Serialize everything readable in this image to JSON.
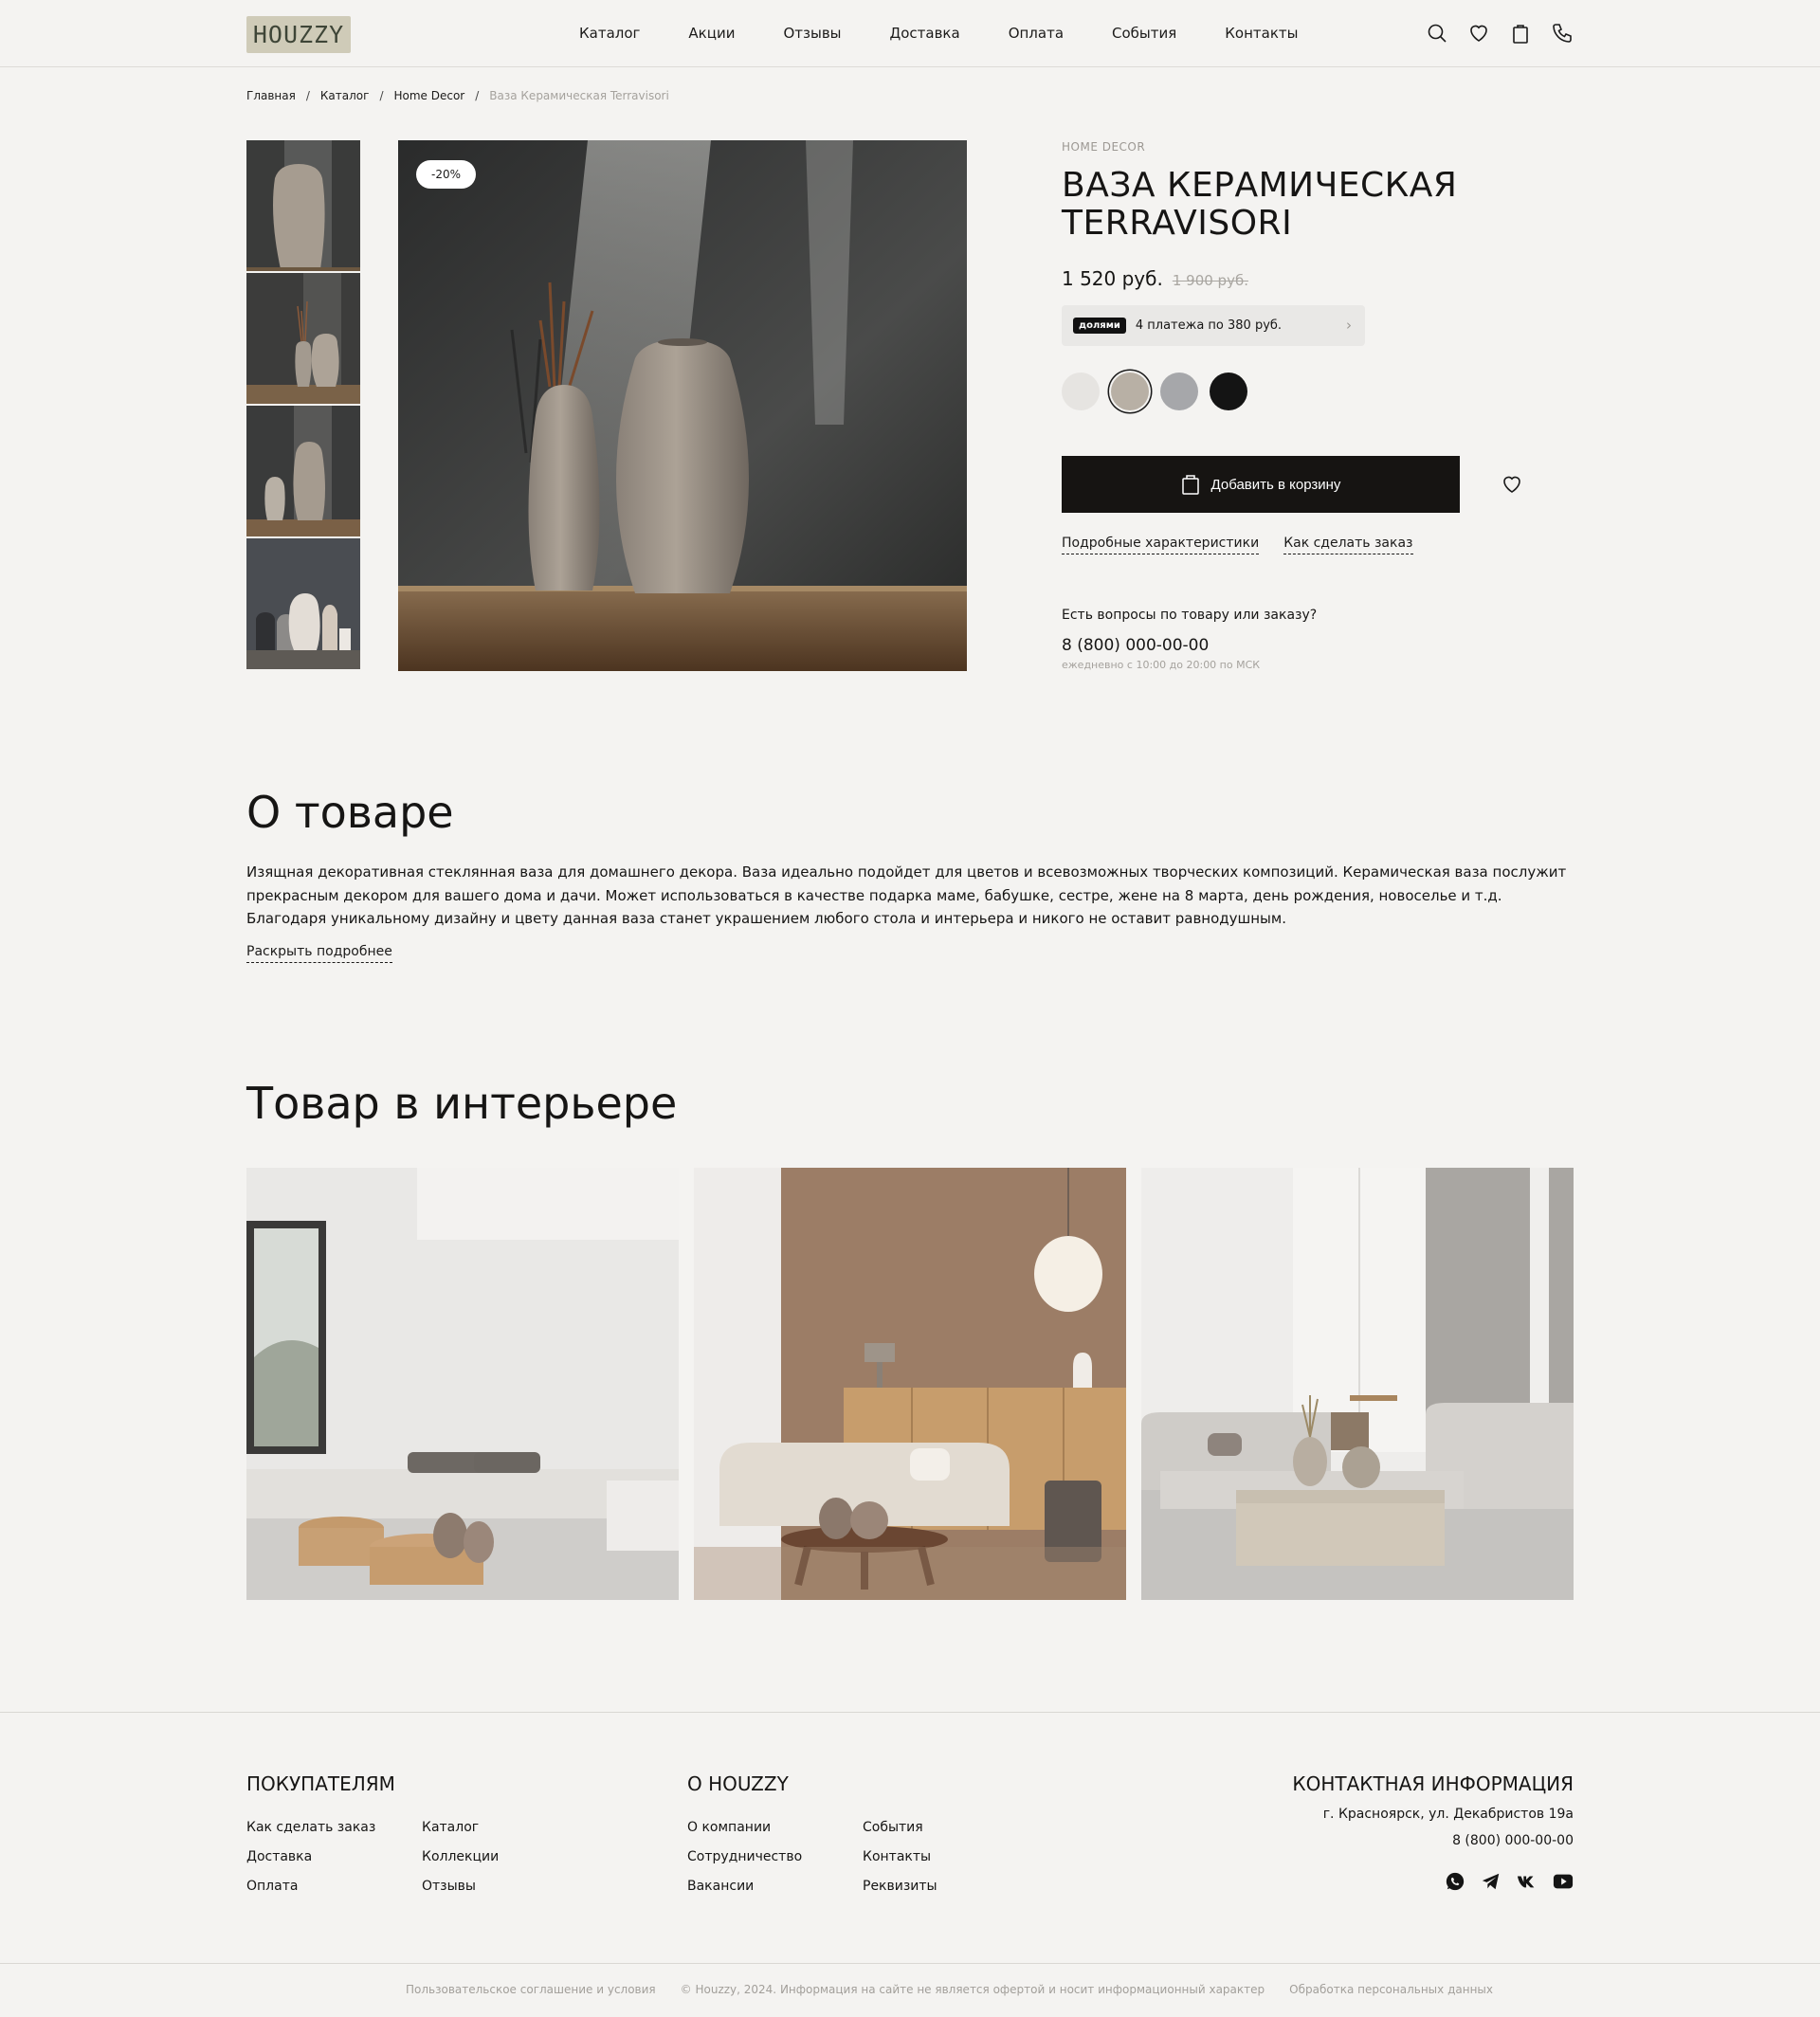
{
  "brand": {
    "logo_text": "HOUZZY"
  },
  "nav": [
    "Каталог",
    "Акции",
    "Отзывы",
    "Доставка",
    "Оплата",
    "События",
    "Контакты"
  ],
  "header_icons": [
    "search-icon",
    "heart-icon",
    "bag-icon",
    "phone-icon"
  ],
  "breadcrumb": [
    "Главная",
    "Каталог",
    "Home Decor",
    "Ваза Керамическая Terravisori"
  ],
  "product": {
    "discount_badge": "-20%",
    "category": "HOME DECOR",
    "title": "ВАЗА КЕРАМИЧЕСКАЯ TERRAVISORI",
    "price": "1 520 руб.",
    "old_price": "1 900 руб.",
    "dolyami_logo": "долями",
    "dolyami_text": "4 платежа по 380 руб.",
    "colors": [
      "#e6e4e1",
      "#b8b0a5",
      "#a6a7aa",
      "#141414"
    ],
    "selected_color_index": 1,
    "add_to_cart": "Добавить в корзину",
    "link_specs": "Подробные характеристики",
    "link_order": "Как сделать заказ",
    "questions_title": "Есть вопросы по товару или заказу?",
    "phone": "8 (800) 000-00-00",
    "hours": "ежедневно с 10:00 до 20:00 по МСК"
  },
  "about": {
    "heading": "О товаре",
    "text": "Изящная декоративная стеклянная ваза для домашнего декора. Ваза идеально подойдет для цветов и всевозможных творческих композиций. Керамическая ваза послужит прекрасным декором для вашего дома и дачи. Может использоваться в качестве подарка маме, бабушке, сестре, жене на 8 марта, день рождения, новоселье и т.д. Благодаря уникальному дизайну и цвету данная ваза станет украшением любого стола и интерьера и никого не оставит равнодушным.",
    "more": "Раскрыть подробнее"
  },
  "interior": {
    "heading": "Товар в интерьере"
  },
  "footer": {
    "buyers": {
      "heading": "ПОКУПАТЕЛЯМ",
      "links": [
        "Как сделать заказ",
        "Каталог",
        "Доставка",
        "Коллекции",
        "Оплата",
        "Отзывы"
      ]
    },
    "about": {
      "heading": "О HOUZZY",
      "links": [
        "О компании",
        "События",
        "Сотрудничество",
        "Контакты",
        "Вакансии",
        "Реквизиты"
      ]
    },
    "contacts": {
      "heading": "КОНТАКТНАЯ ИНФОРМАЦИЯ",
      "address": "г. Красноярск, ул. Декабристов 19а",
      "phone": "8 (800) 000-00-00"
    },
    "socials": [
      "whatsapp-icon",
      "telegram-icon",
      "vk-icon",
      "youtube-icon"
    ],
    "bottom": [
      "Пользовательское соглашение и условия",
      "© Houzzy, 2024. Информация на сайте не является офертой и носит информационный характер",
      "Обработка персональных данных"
    ]
  }
}
